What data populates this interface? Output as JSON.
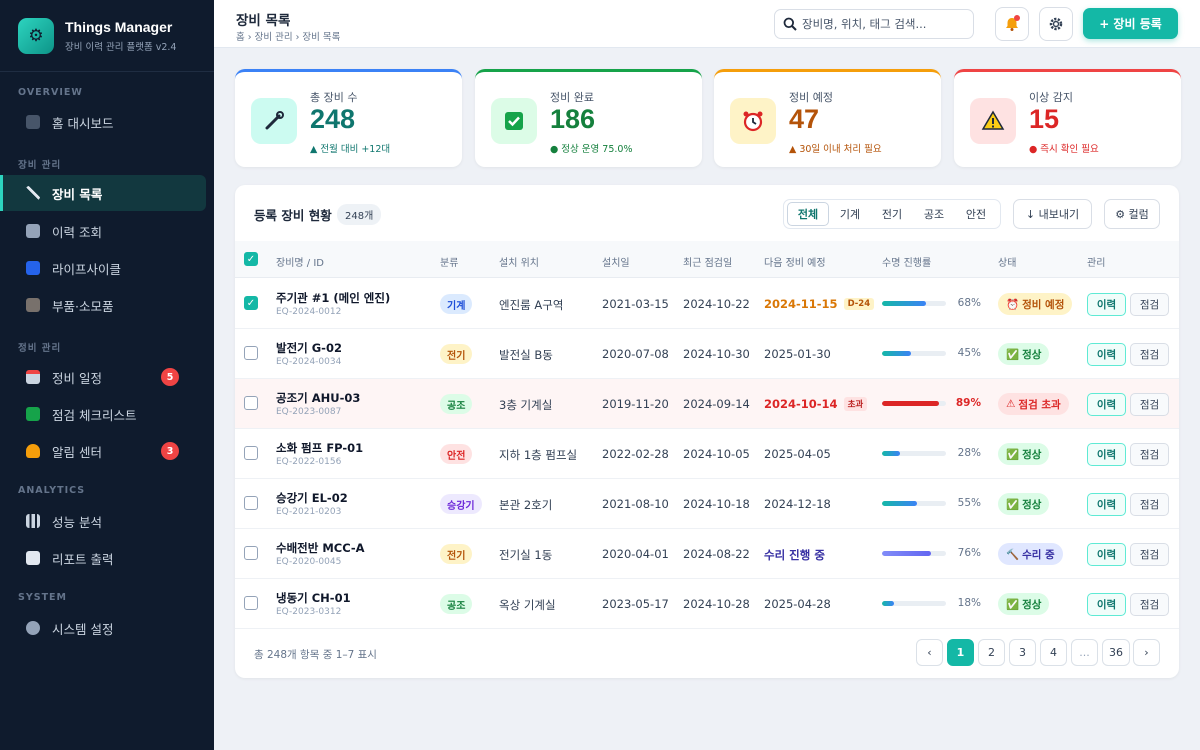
{
  "app": {
    "title": "Things Manager",
    "subtitle": "장비 이력 관리 플랫폼 v2.4"
  },
  "sidebar": {
    "sections": [
      {
        "label": "OVERVIEW"
      },
      {
        "label": "장비 관리"
      },
      {
        "label": "정비 관리"
      },
      {
        "label": "ANALYTICS"
      },
      {
        "label": "SYSTEM"
      }
    ],
    "items": [
      {
        "label": "홈 대시보드",
        "icon": "home-icon"
      },
      {
        "label": "장비 목록",
        "icon": "wrench-icon",
        "active": true
      },
      {
        "label": "이력 조회",
        "icon": "clipboard-icon"
      },
      {
        "label": "라이프사이클",
        "icon": "cycle-icon"
      },
      {
        "label": "부품·소모품",
        "icon": "box-icon"
      },
      {
        "label": "정비 일정",
        "icon": "calendar-icon",
        "badge": "5"
      },
      {
        "label": "점검 체크리스트",
        "icon": "check-icon"
      },
      {
        "label": "알림 센터",
        "icon": "bell-icon",
        "badge": "3"
      },
      {
        "label": "성능 분석",
        "icon": "bar-chart-icon"
      },
      {
        "label": "리포트 출력",
        "icon": "report-icon"
      },
      {
        "label": "시스템 설정",
        "icon": "gear-icon"
      }
    ]
  },
  "header": {
    "title": "장비 목록",
    "breadcrumb": "홈 › 장비 관리 › 장비 목록",
    "search_placeholder": "장비명, 위치, 태그 검색...",
    "add_button": "+ 장비 등록"
  },
  "stats": [
    {
      "label": "총 장비 수",
      "value": "248",
      "sub": "▲ 전월 대비 +12대",
      "color": "#0f766e",
      "icon": "wrench-icon"
    },
    {
      "label": "정비 완료",
      "value": "186",
      "sub": "● 정상 운영 75.0%",
      "color": "#15803d",
      "icon": "check-icon"
    },
    {
      "label": "정비 예정",
      "value": "47",
      "sub": "▲ 30일 이내 처리 필요",
      "color": "#b45309",
      "icon": "alarm-clock-icon"
    },
    {
      "label": "이상 감지",
      "value": "15",
      "sub": "● 즉시 확인 필요",
      "color": "#dc2626",
      "icon": "warning-icon"
    }
  ],
  "panel": {
    "title": "등록 장비 현황",
    "count": "248개",
    "filters": [
      "전체",
      "기계",
      "전기",
      "공조",
      "안전"
    ],
    "export_label": "↓ 내보내기",
    "columns_label": "⚙ 컬럼",
    "headers": [
      "장비명 / ID",
      "분류",
      "설치 위치",
      "설치일",
      "최근 점검일",
      "다음 정비 예정",
      "수명 진행률",
      "상태",
      "관리"
    ],
    "rows": [
      {
        "name": "주기관 #1 (메인 엔진)",
        "id": "EQ-2024-0012",
        "category": "기계",
        "location": "엔진룸 A구역",
        "installed": "2021-03-15",
        "last_check": "2024-10-22",
        "next": "2024-11-15",
        "next_tag": "D-24",
        "progress": 68,
        "progress_label": "68%",
        "status": "정비 예정",
        "status_icon": "⏰",
        "checked": true
      },
      {
        "name": "발전기 G-02",
        "id": "EQ-2024-0034",
        "category": "전기",
        "location": "발전실 B동",
        "installed": "2020-07-08",
        "last_check": "2024-10-30",
        "next": "2025-01-30",
        "next_tag": "",
        "progress": 45,
        "progress_label": "45%",
        "status": "정상",
        "status_icon": "✅",
        "checked": false
      },
      {
        "name": "공조기 AHU-03",
        "id": "EQ-2023-0087",
        "category": "공조",
        "location": "3층 기계실",
        "installed": "2019-11-20",
        "last_check": "2024-09-14",
        "next": "2024-10-14",
        "next_tag": "초과",
        "progress": 89,
        "progress_label": "89%",
        "status": "점검 초과",
        "status_icon": "⚠",
        "checked": false
      },
      {
        "name": "소화 펌프 FP-01",
        "id": "EQ-2022-0156",
        "category": "안전",
        "location": "지하 1층 펌프실",
        "installed": "2022-02-28",
        "last_check": "2024-10-05",
        "next": "2025-04-05",
        "next_tag": "",
        "progress": 28,
        "progress_label": "28%",
        "status": "정상",
        "status_icon": "✅",
        "checked": false
      },
      {
        "name": "승강기 EL-02",
        "id": "EQ-2021-0203",
        "category": "승강기",
        "location": "본관 2호기",
        "installed": "2021-08-10",
        "last_check": "2024-10-18",
        "next": "2024-12-18",
        "next_tag": "",
        "progress": 55,
        "progress_label": "55%",
        "status": "정상",
        "status_icon": "✅",
        "checked": false
      },
      {
        "name": "수배전반 MCC-A",
        "id": "EQ-2020-0045",
        "category": "전기",
        "location": "전기실 1동",
        "installed": "2020-04-01",
        "last_check": "2024-08-22",
        "next": "수리 진행 중",
        "next_tag": "",
        "progress": 76,
        "progress_label": "76%",
        "status": "수리 중",
        "status_icon": "🔨",
        "checked": false
      },
      {
        "name": "냉동기 CH-01",
        "id": "EQ-2023-0312",
        "category": "공조",
        "location": "옥상 기계실",
        "installed": "2023-05-17",
        "last_check": "2024-10-28",
        "next": "2025-04-28",
        "next_tag": "",
        "progress": 18,
        "progress_label": "18%",
        "status": "정상",
        "status_icon": "✅",
        "checked": false
      }
    ],
    "action_history": "이력",
    "action_check": "점검",
    "footer": "총 248개 항목 중 1–7 표시",
    "pages": [
      "‹",
      "1",
      "2",
      "3",
      "4",
      "...",
      "36",
      "›"
    ]
  }
}
